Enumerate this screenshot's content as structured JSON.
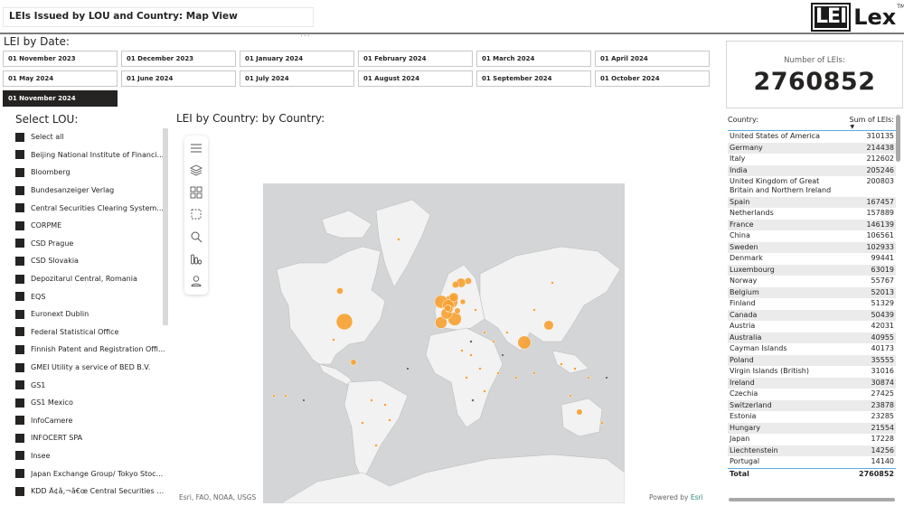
{
  "header": {
    "title": "LEIs Issued by LOU and Country: Map View",
    "more_options": "...",
    "logo": {
      "box_text": "LEI",
      "text": "Lex",
      "tm": "TM"
    }
  },
  "date_slicer": {
    "label": "LEI by Date:",
    "options": [
      "01 November 2023",
      "01 December 2023",
      "01 January 2024",
      "01 February 2024",
      "01 March 2024",
      "01 April 2024",
      "01 May 2024",
      "01 June 2024",
      "01 July 2024",
      "01 August 2024",
      "01 September 2024",
      "01 October 2024",
      "01 November 2024"
    ],
    "selected": "01 November 2024"
  },
  "kpi": {
    "label": "Number of LEIs:",
    "value": "2760852"
  },
  "lou_slicer": {
    "label": "Select LOU:",
    "items": [
      "Select all",
      "Beijing National Institute of Financi...",
      "Bloomberg",
      "Bundesanzeiger Verlag",
      "Central Securities Clearing System...",
      "CORPME",
      "CSD Prague",
      "CSD Slovakia",
      "Depozitarul Central, Romania",
      "EQS",
      "Euronext Dublin",
      "Federal Statistical Office",
      "Finnish Patent and Registration Offi...",
      "GMEI Utility a service of BED B.V.",
      "GS1",
      "GS1 Mexico",
      "InfoCamere",
      "INFOCERT SPA",
      "Insee",
      "Japan Exchange Group/ Tokyo Stoc...",
      "KDD Ã¢â‚¬â€œ Central Securities C..."
    ]
  },
  "map": {
    "title": "LEI by Country: by Country:",
    "toolbar": [
      "menu",
      "layers",
      "legend",
      "selection",
      "search",
      "bars",
      "person"
    ],
    "attribution_left": "Esri, FAO, NOAA, USGS",
    "attribution_right_prefix": "Powered by ",
    "attribution_right_link": "Esri",
    "bubble_color": "#f7a030",
    "nodata_color": "#6b6b6b"
  },
  "country_table": {
    "col_country": "Country:",
    "col_sum": "Sum of LEIs:",
    "sort_indicator": "▼",
    "rows": [
      [
        "United States of America",
        "310135"
      ],
      [
        "Germany",
        "214438"
      ],
      [
        "Italy",
        "212602"
      ],
      [
        "India",
        "205246"
      ],
      [
        "United Kingdom of Great Britain and Northern Ireland",
        "200803"
      ],
      [
        "Spain",
        "167457"
      ],
      [
        "Netherlands",
        "157889"
      ],
      [
        "France",
        "146139"
      ],
      [
        "China",
        "106561"
      ],
      [
        "Sweden",
        "102933"
      ],
      [
        "Denmark",
        "99441"
      ],
      [
        "Luxembourg",
        "63019"
      ],
      [
        "Norway",
        "55767"
      ],
      [
        "Belgium",
        "52013"
      ],
      [
        "Finland",
        "51329"
      ],
      [
        "Canada",
        "50439"
      ],
      [
        "Austria",
        "42031"
      ],
      [
        "Australia",
        "40955"
      ],
      [
        "Cayman Islands",
        "40173"
      ],
      [
        "Poland",
        "35555"
      ],
      [
        "Virgin Islands (British)",
        "31016"
      ],
      [
        "Ireland",
        "30874"
      ],
      [
        "Czechia",
        "27425"
      ],
      [
        "Switzerland",
        "23878"
      ],
      [
        "Estonia",
        "23285"
      ],
      [
        "Hungary",
        "21554"
      ],
      [
        "Japan",
        "17228"
      ],
      [
        "Liechtenstein",
        "14256"
      ],
      [
        "Portugal",
        "14140"
      ]
    ],
    "total_label": "Total",
    "total_value": "2760852"
  }
}
